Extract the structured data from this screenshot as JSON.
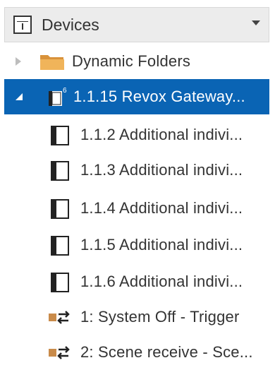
{
  "panel": {
    "title": "Devices",
    "title_icon": "panel-icon",
    "dropdown_icon": "chevron-down-icon"
  },
  "tree": {
    "folder": {
      "label": "Dynamic Folders",
      "icon": "folder-icon",
      "expander": "collapsed"
    },
    "gateway": {
      "label": "1.1.15 Revox Gateway...",
      "badge": "6",
      "icon": "gateway-device-icon",
      "expander": "expanded",
      "selected": true,
      "highlight_color": "#0a64b4"
    },
    "children": [
      {
        "label": "1.1.2 Additional indivi...",
        "icon": "device-icon"
      },
      {
        "label": "1.1.3 Additional indivi...",
        "icon": "device-icon"
      },
      {
        "label": "1.1.4 Additional indivi...",
        "icon": "device-icon"
      },
      {
        "label": "1.1.5 Additional indivi...",
        "icon": "device-icon"
      },
      {
        "label": "1.1.6 Additional indivi...",
        "icon": "device-icon"
      },
      {
        "label": "1: System Off - Trigger",
        "icon": "group-object-icon"
      },
      {
        "label": "2: Scene receive - Sce...",
        "icon": "group-object-icon"
      }
    ]
  }
}
